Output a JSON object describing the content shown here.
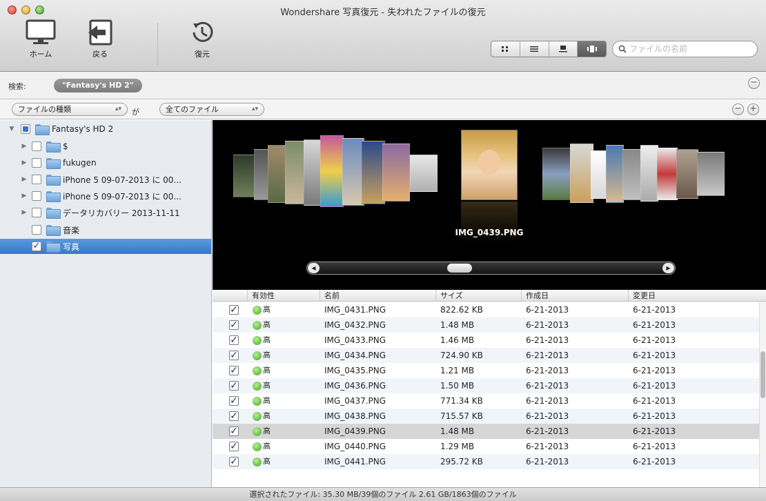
{
  "window": {
    "title": "Wondershare 写真復元 - 失われたファイルの復元"
  },
  "toolbar": {
    "home_label": "ホーム",
    "back_label": "戻る",
    "restore_label": "復元",
    "search_placeholder": "ファイルの名前"
  },
  "search_row": {
    "label": "検索:",
    "token": "\"Fantasy's HD 2\"",
    "remove_symbol": "−"
  },
  "filter_row": {
    "type_popup": "ファイルの種類",
    "connector": "が",
    "files_popup": "全てのファイル",
    "remove_symbol": "−",
    "add_symbol": "+"
  },
  "sidebar": {
    "root": "Fantasy's HD 2",
    "items": [
      {
        "label": "$"
      },
      {
        "label": "fukugen"
      },
      {
        "label": "iPhone 5 09-07-2013 に 00..."
      },
      {
        "label": "iPhone 5 09-07-2013 に 00..."
      },
      {
        "label": "データリカバリー 2013-11-11"
      },
      {
        "label": "音楽"
      },
      {
        "label": "写真"
      }
    ]
  },
  "coverflow": {
    "caption": "IMG_0439.PNG"
  },
  "table": {
    "columns": [
      "有効性",
      "名前",
      "サイズ",
      "作成日",
      "変更日"
    ],
    "rows": [
      {
        "valid": "高",
        "name": "IMG_0431.PNG",
        "size": "822.62 KB",
        "created": "6-21-2013",
        "modified": "6-21-2013"
      },
      {
        "valid": "高",
        "name": "IMG_0432.PNG",
        "size": "1.48 MB",
        "created": "6-21-2013",
        "modified": "6-21-2013"
      },
      {
        "valid": "高",
        "name": "IMG_0433.PNG",
        "size": "1.46 MB",
        "created": "6-21-2013",
        "modified": "6-21-2013"
      },
      {
        "valid": "高",
        "name": "IMG_0434.PNG",
        "size": "724.90 KB",
        "created": "6-21-2013",
        "modified": "6-21-2013"
      },
      {
        "valid": "高",
        "name": "IMG_0435.PNG",
        "size": "1.21 MB",
        "created": "6-21-2013",
        "modified": "6-21-2013"
      },
      {
        "valid": "高",
        "name": "IMG_0436.PNG",
        "size": "1.50 MB",
        "created": "6-21-2013",
        "modified": "6-21-2013"
      },
      {
        "valid": "高",
        "name": "IMG_0437.PNG",
        "size": "771.34 KB",
        "created": "6-21-2013",
        "modified": "6-21-2013"
      },
      {
        "valid": "高",
        "name": "IMG_0438.PNG",
        "size": "715.57 KB",
        "created": "6-21-2013",
        "modified": "6-21-2013"
      },
      {
        "valid": "高",
        "name": "IMG_0439.PNG",
        "size": "1.48 MB",
        "created": "6-21-2013",
        "modified": "6-21-2013"
      },
      {
        "valid": "高",
        "name": "IMG_0440.PNG",
        "size": "1.29 MB",
        "created": "6-21-2013",
        "modified": "6-21-2013"
      },
      {
        "valid": "高",
        "name": "IMG_0441.PNG",
        "size": "295.72 KB",
        "created": "6-21-2013",
        "modified": "6-21-2013"
      }
    ]
  },
  "status": {
    "text": "選択されたファイル: 35.30 MB/39個のファイル  2.61 GB/1863個のファイル"
  },
  "colors": {
    "selection": "#3a78c5",
    "validity_dot": "#43a826",
    "row_alt": "#f1f5fa",
    "row_highlight": "#d6d6d6"
  },
  "icons": [
    "monitor-icon",
    "back-arrow-icon",
    "restore-clock-icon",
    "grid-view-icon",
    "list-view-icon",
    "single-view-icon",
    "coverflow-view-icon",
    "search-icon",
    "folder-icon",
    "checkbox-icon",
    "green-dot-icon"
  ]
}
